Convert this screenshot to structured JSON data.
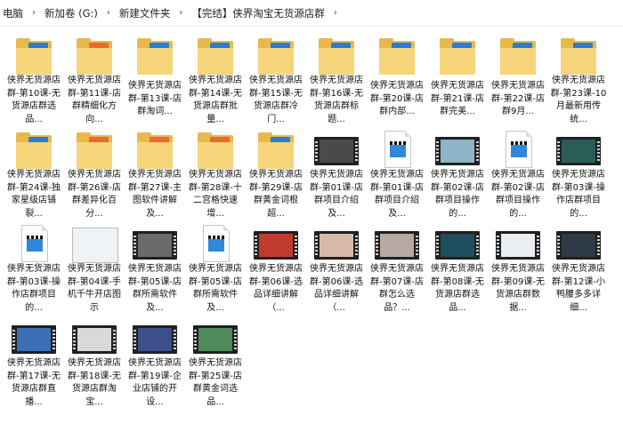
{
  "breadcrumb": [
    "电脑",
    "新加卷 (G:)",
    "新建文件夹",
    "【完结】侠界淘宝无货源店群"
  ],
  "items": [
    {
      "kind": "folder",
      "label": "侠界无货源店群-第10课-无货源店群选品...",
      "color": "#2a7bd4"
    },
    {
      "kind": "folder",
      "label": "侠界无货源店群-第11课-店群精细化方向...",
      "color": "#e86a2c"
    },
    {
      "kind": "folder",
      "label": "侠界无货源店群-第13课-店群淘词...",
      "color": "#2a7bd4"
    },
    {
      "kind": "folder",
      "label": "侠界无货源店群-第14课-无货源店群批量...",
      "color": "#2a7bd4"
    },
    {
      "kind": "folder",
      "label": "侠界无货源店群-第15课-无货源店群冷门...",
      "color": "#2a7bd4"
    },
    {
      "kind": "folder",
      "label": "侠界无货源店群-第16课-无货源店群标题...",
      "color": "#2a7bd4"
    },
    {
      "kind": "folder",
      "label": "侠界无货源店群-第20课-店群内部...",
      "color": "#2a7bd4"
    },
    {
      "kind": "folder",
      "label": "侠界无货源店群-第21课-店群完美...",
      "color": "#2a7bd4"
    },
    {
      "kind": "folder",
      "label": "侠界无货源店群-第22课-店群9月...",
      "color": "#2a7bd4"
    },
    {
      "kind": "folder",
      "label": "侠界无货源店群-第23课-10月最新用传统...",
      "color": "#2a7bd4"
    },
    {
      "kind": "folder",
      "label": "侠界无货源店群-第24课-独家星级店铺裂...",
      "color": "#2a7bd4"
    },
    {
      "kind": "folder",
      "label": "侠界无货源店群-第26课-店群差异化百分...",
      "color": "#e86a2c"
    },
    {
      "kind": "folder",
      "label": "侠界无货源店群-第27课-主图软件讲解及...",
      "color": "#e86a2c"
    },
    {
      "kind": "folder",
      "label": "侠界无货源店群-第28课-十二宫格快速增...",
      "color": "#e86a2c"
    },
    {
      "kind": "folder",
      "label": "侠界无货源店群-第29课-店群黄金词根超...",
      "color": "#2a7bd4"
    },
    {
      "kind": "video",
      "label": "侠界无货源店群-第01课-店群项目介绍及...",
      "screen": "#4a4a4a"
    },
    {
      "kind": "doc",
      "label": "侠界无货源店群-第01课-店群项目介绍及..."
    },
    {
      "kind": "video",
      "label": "侠界无货源店群-第02课-店群项目操作的...",
      "screen": "#8fb4c8"
    },
    {
      "kind": "doc",
      "label": "侠界无货源店群-第02课-店群项目操作的..."
    },
    {
      "kind": "video",
      "label": "侠界无货源店群-第03课-操作店群项目的...",
      "screen": "#2a5d58"
    },
    {
      "kind": "doc",
      "label": "侠界无货源店群-第03课-操作店群项目的..."
    },
    {
      "kind": "pic",
      "label": "侠界无货源店群-第04课-手机千牛开店图示"
    },
    {
      "kind": "video",
      "label": "侠界无货源店群-第05课-店群所需软件及...",
      "screen": "#6a6a6a"
    },
    {
      "kind": "doc",
      "label": "侠界无货源店群-第05课-店群所需软件及..."
    },
    {
      "kind": "video",
      "label": "侠界无货源店群-第06课-选品详细讲解（...",
      "screen": "#c23a2e"
    },
    {
      "kind": "video",
      "label": "侠界无货源店群-第06课-选品详细讲解（...",
      "screen": "#d7b9a8"
    },
    {
      "kind": "video",
      "label": "侠界无货源店群-第07课-店群怎么选品？...",
      "screen": "#b7a9a2"
    },
    {
      "kind": "video",
      "label": "侠界无货源店群-第08课-无货源店群选品...",
      "screen": "#1f4e5c"
    },
    {
      "kind": "video",
      "label": "侠界无货源店群-第09课-无货源店群数据...",
      "screen": "#e9eef3"
    },
    {
      "kind": "video",
      "label": "侠界无货源店群-第12课-小鸭腰多多详细...",
      "screen": "#2f3a48"
    },
    {
      "kind": "video",
      "label": "侠界无货源店群-第17课-无货源店群直播...",
      "screen": "#3b6fb5"
    },
    {
      "kind": "video",
      "label": "侠界无货源店群-第18课-无货源店群淘宝...",
      "screen": "#d9d9d9"
    },
    {
      "kind": "video",
      "label": "侠界无货源店群-第19课-企业店铺的开设...",
      "screen": "#3c4f8a"
    },
    {
      "kind": "video",
      "label": "侠界无货源店群-第25课-店群黄金词选品...",
      "screen": "#4f8a5a"
    }
  ]
}
